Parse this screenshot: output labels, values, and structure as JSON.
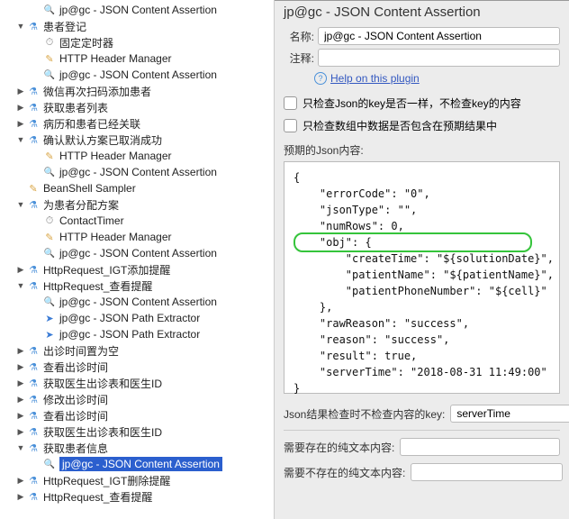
{
  "tree": [
    {
      "indent": 2,
      "arrow": "none",
      "icon": "mag",
      "label": "jp@gc - JSON Content Assertion"
    },
    {
      "indent": 1,
      "arrow": "open",
      "icon": "flask",
      "label": "患者登记"
    },
    {
      "indent": 2,
      "arrow": "none",
      "icon": "timer",
      "label": "固定定时器"
    },
    {
      "indent": 2,
      "arrow": "none",
      "icon": "hdr",
      "label": "HTTP Header Manager"
    },
    {
      "indent": 2,
      "arrow": "none",
      "icon": "mag",
      "label": "jp@gc - JSON Content Assertion"
    },
    {
      "indent": 1,
      "arrow": "closed",
      "icon": "flask",
      "label": "微信再次扫码添加患者"
    },
    {
      "indent": 1,
      "arrow": "closed",
      "icon": "flask",
      "label": "获取患者列表"
    },
    {
      "indent": 1,
      "arrow": "closed",
      "icon": "flask",
      "label": "病历和患者已经关联"
    },
    {
      "indent": 1,
      "arrow": "open",
      "icon": "flask",
      "label": "确认默认方案已取消成功"
    },
    {
      "indent": 2,
      "arrow": "none",
      "icon": "hdr",
      "label": "HTTP Header Manager"
    },
    {
      "indent": 2,
      "arrow": "none",
      "icon": "mag",
      "label": "jp@gc - JSON Content Assertion"
    },
    {
      "indent": 1,
      "arrow": "none",
      "icon": "leaf",
      "label": "BeanShell Sampler"
    },
    {
      "indent": 1,
      "arrow": "open",
      "icon": "flask",
      "label": "为患者分配方案"
    },
    {
      "indent": 2,
      "arrow": "none",
      "icon": "timer",
      "label": "ContactTimer"
    },
    {
      "indent": 2,
      "arrow": "none",
      "icon": "hdr",
      "label": "HTTP Header Manager"
    },
    {
      "indent": 2,
      "arrow": "none",
      "icon": "mag",
      "label": "jp@gc - JSON Content Assertion"
    },
    {
      "indent": 1,
      "arrow": "closed",
      "icon": "flask",
      "label": "HttpRequest_IGT添加提醒"
    },
    {
      "indent": 1,
      "arrow": "open",
      "icon": "flask",
      "label": "HttpRequest_查看提醒"
    },
    {
      "indent": 2,
      "arrow": "none",
      "icon": "mag",
      "label": "jp@gc - JSON Content Assertion"
    },
    {
      "indent": 2,
      "arrow": "none",
      "icon": "path",
      "label": "jp@gc - JSON Path Extractor"
    },
    {
      "indent": 2,
      "arrow": "none",
      "icon": "path",
      "label": "jp@gc - JSON Path Extractor"
    },
    {
      "indent": 1,
      "arrow": "closed",
      "icon": "flask",
      "label": "出诊时间置为空"
    },
    {
      "indent": 1,
      "arrow": "closed",
      "icon": "flask",
      "label": "查看出诊时间"
    },
    {
      "indent": 1,
      "arrow": "closed",
      "icon": "flask",
      "label": "获取医生出诊表和医生ID"
    },
    {
      "indent": 1,
      "arrow": "closed",
      "icon": "flask",
      "label": "修改出诊时间"
    },
    {
      "indent": 1,
      "arrow": "closed",
      "icon": "flask",
      "label": "查看出诊时间"
    },
    {
      "indent": 1,
      "arrow": "closed",
      "icon": "flask",
      "label": "获取医生出诊表和医生ID"
    },
    {
      "indent": 1,
      "arrow": "open",
      "icon": "flask",
      "label": "获取患者信息"
    },
    {
      "indent": 2,
      "arrow": "none",
      "icon": "mag",
      "label": "jp@gc - JSON Content Assertion",
      "selected": true
    },
    {
      "indent": 1,
      "arrow": "closed",
      "icon": "flask",
      "label": "HttpRequest_IGT删除提醒"
    },
    {
      "indent": 1,
      "arrow": "closed",
      "icon": "flask",
      "label": "HttpRequest_查看提醒"
    }
  ],
  "panel": {
    "title": "jp@gc - JSON Content Assertion",
    "name_lbl": "名称:",
    "name_val": "jp@gc - JSON Content Assertion",
    "comment_lbl": "注释:",
    "comment_val": "",
    "help_text": "Help on this plugin",
    "chk1": "只检查Json的key是否一样，不检查key的内容",
    "chk2": "只检查数组中数据是否包含在预期结果中",
    "expected_lbl": "预期的Json内容:",
    "json_lines": [
      "{",
      "    \"errorCode\": \"0\",",
      "    \"jsonType\": \"\",",
      "    \"numRows\": 0,",
      "    \"obj\": {",
      "        \"createTime\": \"${solutionDate}\",",
      "        \"patientName\": \"${patientName}\",",
      "        \"patientPhoneNumber\": \"${cell}\"",
      "    },",
      "    \"rawReason\": \"success\",",
      "    \"reason\": \"success\",",
      "    \"result\": true,",
      "    \"serverTime\": \"2018-08-31 11:49:00\"",
      "}"
    ],
    "ignore_key_lbl": "Json结果检查时不检查内容的key:",
    "ignore_key_val": "serverTime",
    "need_exist_lbl": "需要存在的纯文本内容:",
    "need_exist_val": "",
    "need_notexist_lbl": "需要不存在的纯文本内容:",
    "need_notexist_val": ""
  }
}
